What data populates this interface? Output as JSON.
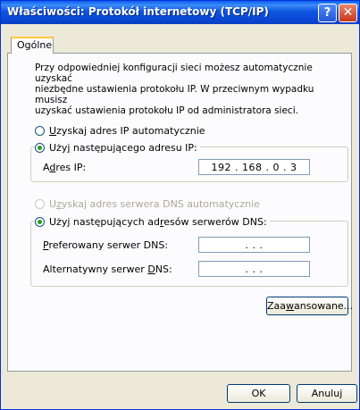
{
  "window": {
    "title": "Właściwości: Protokół internetowy (TCP/IP)",
    "help_icon": "?",
    "close_icon": "✕"
  },
  "tabs": [
    {
      "label": "Ogólne",
      "active": true
    }
  ],
  "description": "Przy odpowiedniej konfiguracji sieci możesz automatycznie uzyskać\nniezbędne ustawienia protokołu IP. W przeciwnym wypadku musisz\nuzyskać ustawienia protokołu IP od administratora sieci.",
  "ip": {
    "auto": {
      "pre": "",
      "key": "U",
      "post": "zyskaj adres IP automatycznie",
      "checked": false
    },
    "manual": {
      "pre": "Uży",
      "key": "j",
      "post": " następującego adresu IP:",
      "checked": true
    },
    "address_label": {
      "pre": "A",
      "key": "d",
      "post": "res IP:"
    },
    "address_value": "192 . 168 .  0  .  3"
  },
  "dns": {
    "auto": {
      "pre": "U",
      "key": "z",
      "post": "yskaj adres serwera DNS automatycznie",
      "checked": false,
      "enabled": false
    },
    "manual": {
      "pre": "Użyj następujących ad",
      "key": "r",
      "post": "esów serwerów DNS:",
      "checked": true
    },
    "preferred_label": {
      "pre": "",
      "key": "P",
      "post": "referowany serwer DNS:"
    },
    "preferred_value": ".        .        .",
    "alternate_label": {
      "pre": "Alternatywny serwer ",
      "key": "D",
      "post": "NS:"
    },
    "alternate_value": ".        .        ."
  },
  "buttons": {
    "advanced": {
      "pre": "Zaa",
      "key": "w",
      "post": "ansowane..."
    },
    "ok": "OK",
    "cancel": "Anuluj"
  },
  "colors": {
    "titlebar": "#0a5ef0",
    "selected_radio": "#21a121",
    "tab_highlight": "#ffc83c"
  }
}
